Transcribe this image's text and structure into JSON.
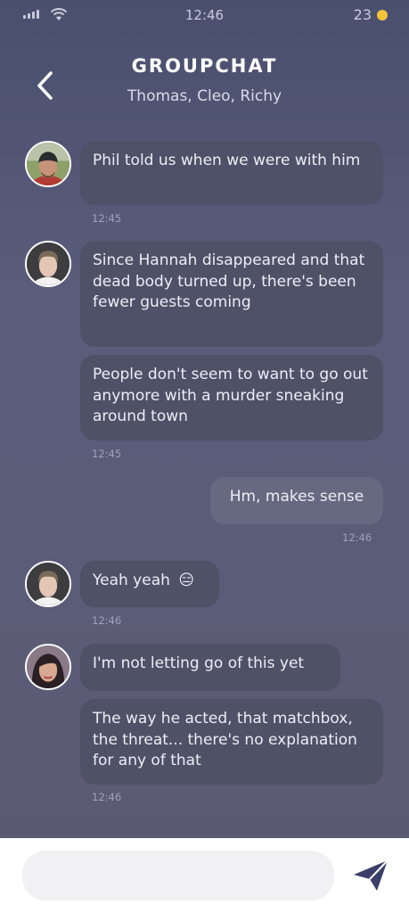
{
  "status_bar": {
    "time": "12:46",
    "coins": "23"
  },
  "header": {
    "title": "GROUPCHAT",
    "subtitle": "Thomas, Cleo, Richy"
  },
  "messages": [
    {
      "text": "Phil told us when we were with him",
      "time": "12:45"
    },
    {
      "text": "Since Hannah disappeared and that dead body turned up, there's been fewer guests coming"
    },
    {
      "text": "People don't seem to want to go out anymore with a murder sneaking around town",
      "time": "12:45"
    },
    {
      "text": "Hm, makes sense",
      "time": "12:46"
    },
    {
      "text": "Yeah yeah",
      "emoji": "😑",
      "time": "12:46"
    },
    {
      "text": "I'm not letting go of this yet"
    },
    {
      "text": "The way he acted, that matchbox, the threat... there's no explanation for any of that",
      "time": "12:46"
    }
  ],
  "composer": {
    "value": "",
    "placeholder": ""
  },
  "colors": {
    "accent": "#3a3f6a",
    "coin": "#f2c43a"
  }
}
